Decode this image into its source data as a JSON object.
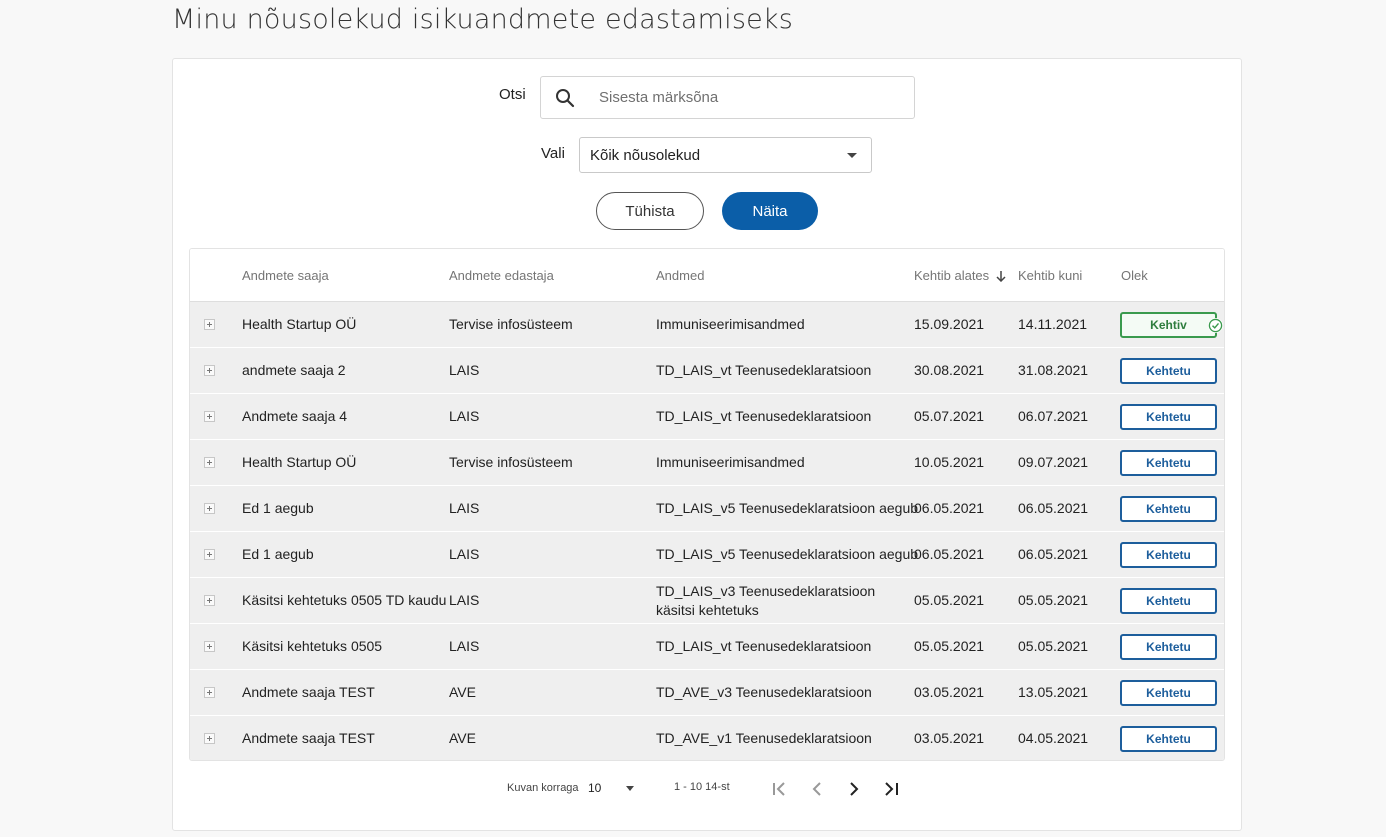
{
  "page": {
    "title": "Minu nõusolekud isikuandmete edastamiseks"
  },
  "search": {
    "label": "Otsi",
    "placeholder": "Sisesta märksõna",
    "value": ""
  },
  "filter": {
    "label": "Vali",
    "selected": "Kõik nõusolekud"
  },
  "actions": {
    "cancel_label": "Tühista",
    "show_label": "Näita"
  },
  "table": {
    "columns": [
      "Andmete saaja",
      "Andmete edastaja",
      "Andmed",
      "Kehtib alates",
      "Kehtib kuni",
      "Olek"
    ],
    "sort_column": "Kehtib alates",
    "sort_direction": "descending",
    "rows": [
      {
        "recipient": "Health Startup OÜ",
        "provider": "Tervise infosüsteem",
        "data": "Immuniseerimisandmed",
        "valid_from": "15.09.2021",
        "valid_to": "14.11.2021",
        "status": "Kehtiv"
      },
      {
        "recipient": "andmete saaja 2",
        "provider": "LAIS",
        "data": "TD_LAIS_vt Teenusedeklaratsioon",
        "valid_from": "30.08.2021",
        "valid_to": "31.08.2021",
        "status": "Kehtetu"
      },
      {
        "recipient": "Andmete saaja 4",
        "provider": "LAIS",
        "data": "TD_LAIS_vt Teenusedeklaratsioon",
        "valid_from": "05.07.2021",
        "valid_to": "06.07.2021",
        "status": "Kehtetu"
      },
      {
        "recipient": "Health Startup OÜ",
        "provider": "Tervise infosüsteem",
        "data": "Immuniseerimisandmed",
        "valid_from": "10.05.2021",
        "valid_to": "09.07.2021",
        "status": "Kehtetu"
      },
      {
        "recipient": "Ed 1 aegub",
        "provider": "LAIS",
        "data": "TD_LAIS_v5 Teenusedeklaratsioon aegub",
        "valid_from": "06.05.2021",
        "valid_to": "06.05.2021",
        "status": "Kehtetu"
      },
      {
        "recipient": "Ed 1 aegub",
        "provider": "LAIS",
        "data": "TD_LAIS_v5 Teenusedeklaratsioon aegub",
        "valid_from": "06.05.2021",
        "valid_to": "06.05.2021",
        "status": "Kehtetu"
      },
      {
        "recipient": "Käsitsi kehtetuks 0505 TD kaudu",
        "provider": "LAIS",
        "data": "TD_LAIS_v3 Teenusedeklaratsioon käsitsi kehtetuks",
        "valid_from": "05.05.2021",
        "valid_to": "05.05.2021",
        "status": "Kehtetu"
      },
      {
        "recipient": "Käsitsi kehtetuks 0505",
        "provider": "LAIS",
        "data": "TD_LAIS_vt Teenusedeklaratsioon",
        "valid_from": "05.05.2021",
        "valid_to": "05.05.2021",
        "status": "Kehtetu"
      },
      {
        "recipient": "Andmete saaja TEST",
        "provider": "AVE",
        "data": "TD_AVE_v3 Teenusedeklaratsioon",
        "valid_from": "03.05.2021",
        "valid_to": "13.05.2021",
        "status": "Kehtetu"
      },
      {
        "recipient": "Andmete saaja TEST",
        "provider": "AVE",
        "data": "TD_AVE_v1 Teenusedeklaratsioon",
        "valid_from": "03.05.2021",
        "valid_to": "04.05.2021",
        "status": "Kehtetu"
      }
    ]
  },
  "pagination": {
    "per_page_label": "Kuvan korraga",
    "per_page_value": "10",
    "range_text": "1 - 10 14-st"
  },
  "icons": {
    "search": "search-icon",
    "dropdown": "chevron-down-icon",
    "sort": "arrow-down-icon",
    "expand": "plus-icon",
    "valid": "check-circle-icon",
    "first": "first-page-icon",
    "prev": "chevron-left-icon",
    "next": "chevron-right-icon",
    "last": "last-page-icon"
  },
  "colors": {
    "primary": "#0b5ea8",
    "status_valid": "#3a9a4e",
    "status_invalid": "#1d5e9c",
    "row_background": "#efefef"
  }
}
